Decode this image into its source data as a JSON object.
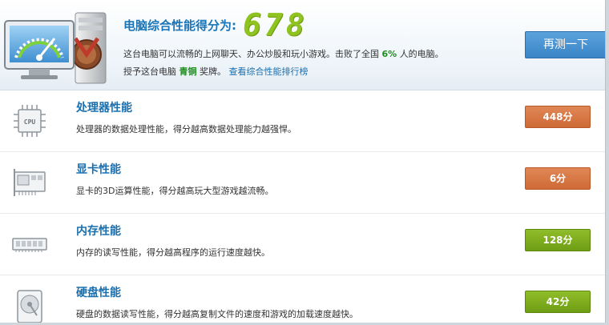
{
  "header": {
    "score_label": "电脑综合性能得分为:",
    "score_value": "678",
    "summary_prefix": "这台电脑可以流畅的上网聊天、办公炒股和玩小游戏。击败了全国",
    "beat_percent": "6%",
    "summary_suffix": "人的电脑。",
    "award_prefix": "授予这台电脑",
    "award_medal": "青铜",
    "award_suffix": "奖牌。",
    "rank_link": "查看综合性能排行榜",
    "retest_label": "再测一下"
  },
  "rows": [
    {
      "title": "处理器性能",
      "desc": "处理器的数据处理性能，得分越高数据处理能力越强悍。",
      "score": "448分",
      "icon": "cpu-icon",
      "status_color": "#d8743f"
    },
    {
      "title": "显卡性能",
      "desc": "显卡的3D运算性能，得分越高玩大型游戏越流畅。",
      "score": "6分",
      "icon": "graphics-card-icon",
      "status_color": "#d8743f"
    },
    {
      "title": "内存性能",
      "desc": "内存的读写性能，得分越高程序的运行速度越快。",
      "score": "128分",
      "icon": "memory-icon",
      "status_color": "#7fae1f"
    },
    {
      "title": "硬盘性能",
      "desc": "硬盘的数据读写性能，得分越高复制文件的速度和游戏的加载速度越快。",
      "score": "42分",
      "icon": "hard-disk-icon",
      "status_color": "#7fae1f"
    }
  ]
}
